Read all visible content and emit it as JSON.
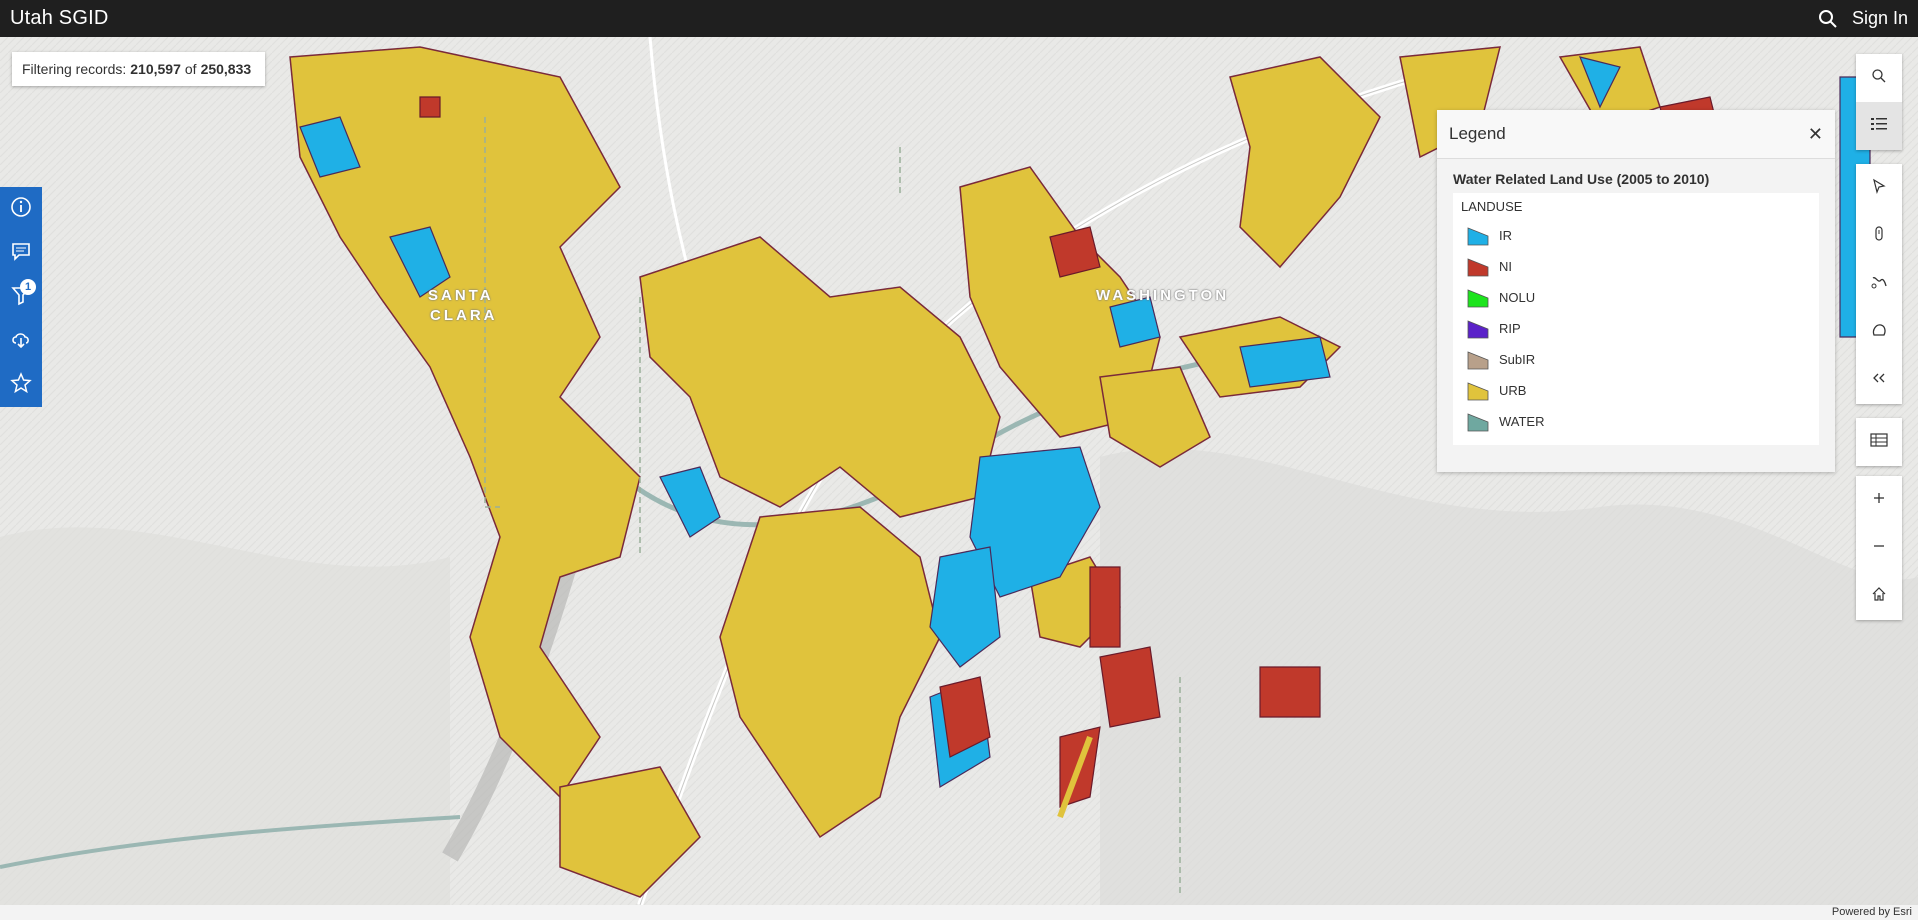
{
  "header": {
    "title": "Utah SGID",
    "sign_in_label": "Sign In"
  },
  "filter": {
    "prefix": "Filtering records:",
    "filtered": "210,597",
    "connector": "of",
    "total": "250,833"
  },
  "map": {
    "place_labels": [
      "SANTA",
      "CLARA",
      "WASHINGTON"
    ],
    "attribution": "Powered by Esri"
  },
  "left_tools": [
    {
      "icon": "info-icon"
    },
    {
      "icon": "comment-icon"
    },
    {
      "icon": "filter-icon",
      "badge": "1"
    },
    {
      "icon": "download-icon"
    },
    {
      "icon": "star-icon"
    }
  ],
  "right_tools": [
    "search-icon",
    "legend-list-icon",
    "select-icon",
    "measure-icon",
    "lasso-icon",
    "shape-icon",
    "collapse-icon",
    "table-icon",
    "zoom-in-icon",
    "zoom-out-icon",
    "home-icon"
  ],
  "legend": {
    "title": "Legend",
    "layer_title": "Water Related Land Use (2005 to 2010)",
    "field": "LANDUSE",
    "items": [
      {
        "label": "IR",
        "color": "#1fb0e6"
      },
      {
        "label": "NI",
        "color": "#c0392b"
      },
      {
        "label": "NOLU",
        "color": "#1de41d"
      },
      {
        "label": "RIP",
        "color": "#5b22c9"
      },
      {
        "label": "SubIR",
        "color": "#b8a08a"
      },
      {
        "label": "URB",
        "color": "#e0c33c"
      },
      {
        "label": "WATER",
        "color": "#6fa8a0"
      }
    ]
  }
}
